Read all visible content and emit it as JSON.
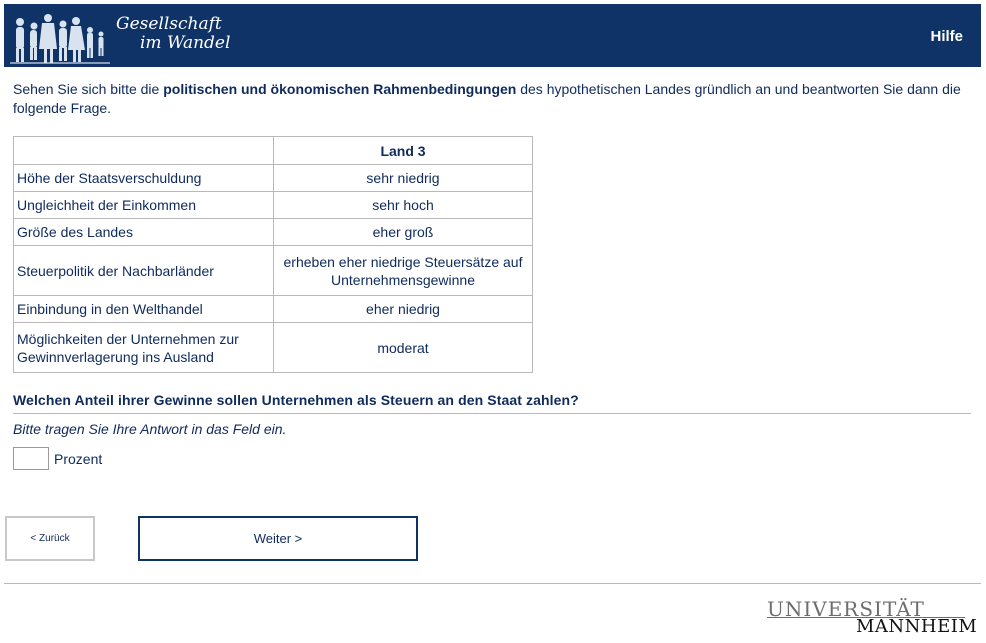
{
  "header": {
    "logo_line1": "Gesellschaft",
    "logo_line2": "im Wandel",
    "logo_icon": "people-silhouettes-icon",
    "help_label": "Hilfe",
    "background_color": "#0f3367"
  },
  "intro": {
    "before": "Sehen Sie sich bitte die ",
    "bold": "politischen und ökonomischen Rahmenbedingungen",
    "after": " des hypothetischen Landes gründlich an und beantworten Sie dann die folgende Frage."
  },
  "table": {
    "column_header": "Land 3",
    "rows": [
      {
        "label": "Höhe der Staatsverschuldung",
        "value": "sehr niedrig"
      },
      {
        "label": "Ungleichheit der Einkommen",
        "value": "sehr hoch"
      },
      {
        "label": "Größe des Landes",
        "value": "eher groß"
      },
      {
        "label": "Steuerpolitik der Nachbarländer",
        "value": "erheben eher niedrige Steuersätze auf Unternehmensgewinne"
      },
      {
        "label": "Einbindung in den Welthandel",
        "value": "eher niedrig"
      },
      {
        "label": "Möglichkeiten der Unternehmen zur Gewinnverlagerung ins Ausland",
        "value": "moderat"
      }
    ]
  },
  "question": {
    "text": "Welchen Anteil ihrer Gewinne sollen Unternehmen als Steuern an den Staat zahlen?",
    "instruction": "Bitte tragen Sie Ihre Antwort in das Feld ein.",
    "answer_value": "",
    "unit": "Prozent"
  },
  "nav": {
    "back_label": "< Zurück",
    "next_label": "Weiter >"
  },
  "footer": {
    "university_line1": "UNIVERSITÄT",
    "university_line2": "MANNHEIM"
  }
}
